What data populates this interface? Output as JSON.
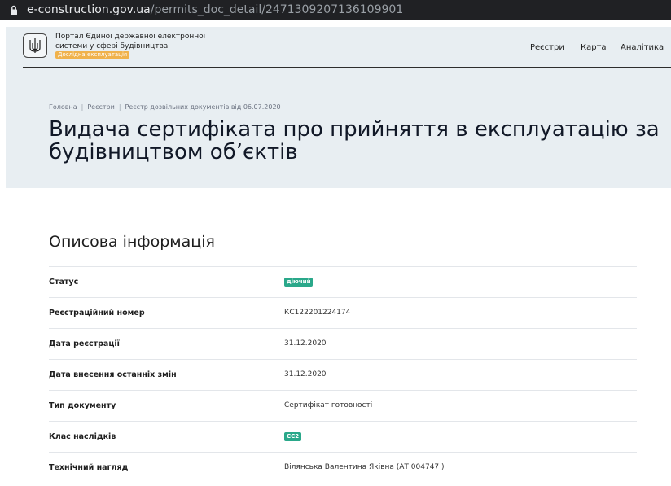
{
  "browser": {
    "url_host": "e-construction.gov.ua",
    "url_path": "/permits_doc_detail/2471309207136109901"
  },
  "header": {
    "portal_name": "Портал Єдиної державної електронної системи у сфері будівництва",
    "beta_label": "Дослідна експлуатація",
    "nav": [
      "Реєстри",
      "Карта",
      "Аналітика"
    ]
  },
  "breadcrumb": [
    "Головна",
    "Реєстри",
    "Реєстр дозвільних документів від 06.07.2020"
  ],
  "page_title": "Видача сертифіката про прийняття в експлуатацію за\nбудівництвом об’єктів",
  "section": {
    "title": "Описова інформація",
    "rows": [
      {
        "label": "Статус",
        "value": "діючий",
        "badge": true
      },
      {
        "label": "Реєстраційний номер",
        "value": "КС122201224174",
        "badge": false
      },
      {
        "label": "Дата реєстрації",
        "value": "31.12.2020",
        "badge": false
      },
      {
        "label": "Дата внесення останніх змін",
        "value": "31.12.2020",
        "badge": false
      },
      {
        "label": "Тип документу",
        "value": "Сертифікат готовності",
        "badge": false
      },
      {
        "label": "Клас наслідків",
        "value": "СС2",
        "badge": true
      },
      {
        "label": "Технічний нагляд",
        "value": "Вілянська Валентина Яківна (АТ 004747 )",
        "badge": false
      }
    ]
  },
  "colors": {
    "hero_bg": "#e8eef2",
    "badge_green": "#2aa88a",
    "beta_orange": "#f0b24c"
  }
}
